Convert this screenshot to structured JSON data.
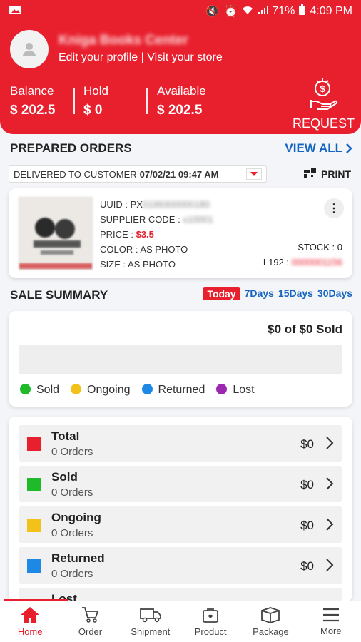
{
  "status_bar": {
    "battery": "71%",
    "time": "4:09 PM"
  },
  "header": {
    "store_name": "Kniga Books Center",
    "profile_links": "Edit your profile | Visit your store",
    "balance": {
      "label": "Balance",
      "value": "$ 202.5"
    },
    "hold": {
      "label": "Hold",
      "value": "$ 0"
    },
    "available": {
      "label": "Available",
      "value": "$ 202.5"
    },
    "request_label": "REQUEST"
  },
  "prepared_orders": {
    "title": "PREPARED ORDERS",
    "view_all": "VIEW ALL",
    "filter_status": "DELIVERED TO CUSTOMER",
    "filter_date": "07/02/21 09:47 AM",
    "print_label": "PRINT",
    "order": {
      "uuid_label": "UUID : PX",
      "uuid_value": "0199300000180",
      "supplier_label": "SUPPLIER CODE :",
      "supplier_value": "s10001",
      "price_label": "PRICE :",
      "price_value": "$3.5",
      "color": "COLOR : AS PHOTO",
      "size": "SIZE : AS PHOTO",
      "stock": "STOCK : 0",
      "l192_label": "L192 :",
      "l192_value": "0000001156"
    }
  },
  "sale_summary": {
    "title": "SALE SUMMARY",
    "periods": [
      "Today",
      "7Days",
      "15Days",
      "30Days"
    ],
    "sold_total": "$0 of $0 Sold",
    "legend": [
      {
        "label": "Sold",
        "color": "#1fba2a"
      },
      {
        "label": "Ongoing",
        "color": "#f3c21a"
      },
      {
        "label": "Returned",
        "color": "#1e88e5"
      },
      {
        "label": "Lost",
        "color": "#9c27b0"
      }
    ]
  },
  "order_rows": [
    {
      "name": "Total",
      "count": "0 Orders",
      "amount": "$0",
      "color": "#e8202e"
    },
    {
      "name": "Sold",
      "count": "0 Orders",
      "amount": "$0",
      "color": "#1fba2a"
    },
    {
      "name": "Ongoing",
      "count": "0 Orders",
      "amount": "$0",
      "color": "#f3c21a"
    },
    {
      "name": "Returned",
      "count": "0 Orders",
      "amount": "$0",
      "color": "#1e88e5"
    },
    {
      "name": "Lost",
      "count": "",
      "amount": "",
      "color": "#9c27b0"
    }
  ],
  "bottom_nav": [
    {
      "label": "Home",
      "icon": "home-icon"
    },
    {
      "label": "Order",
      "icon": "cart-icon"
    },
    {
      "label": "Shipment",
      "icon": "truck-icon"
    },
    {
      "label": "Product",
      "icon": "product-icon"
    },
    {
      "label": "Package",
      "icon": "package-icon"
    },
    {
      "label": "More",
      "icon": "menu-icon"
    }
  ]
}
